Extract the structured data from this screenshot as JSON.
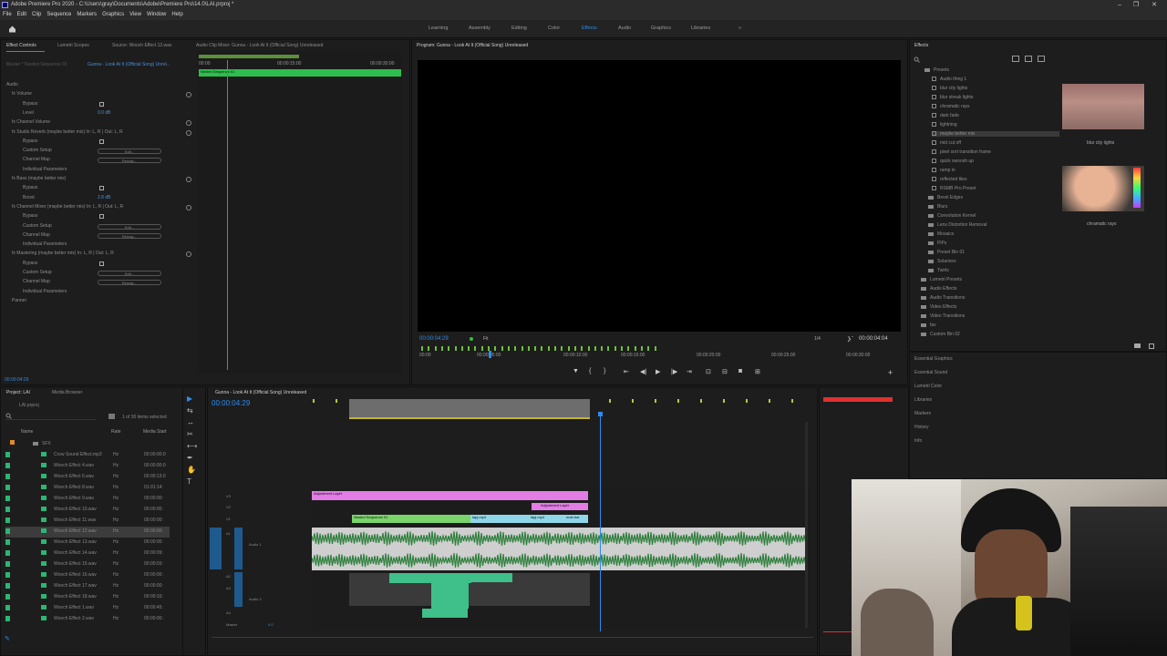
{
  "app": {
    "title": "Adobe Premiere Pro 2020 - C:\\Users\\gray\\Documents\\Adobe\\Premiere Pro\\14.0\\LAI.prproj *",
    "menu": [
      "File",
      "Edit",
      "Clip",
      "Sequence",
      "Markers",
      "Graphics",
      "View",
      "Window",
      "Help"
    ]
  },
  "workspaces": [
    "Learning",
    "Assembly",
    "Editing",
    "Color",
    "Effects",
    "Audio",
    "Graphics",
    "Libraries"
  ],
  "active_workspace": "Effects",
  "more_glyph": "»",
  "source_panel": {
    "tabs": [
      "Effect Controls",
      "Lumetri Scopes",
      "Source: Wooch Effect 12.wav",
      "Audio Clip Mixer: Gunna - Look At It (Official Song) Unreleased"
    ],
    "clip_path": "Master * Nested Sequence 01",
    "clip_name": "Gunna - Look At It (Official Song) Unrel...",
    "time_start": "00:00",
    "time_mid": "00:00:15:00",
    "time_end": "00:00:30:00",
    "nested_clip": "Nested Sequence 01",
    "timecode": "00:00:04:29",
    "rows": [
      {
        "text": "Audio",
        "indent": 0
      },
      {
        "text": "fx  Volume",
        "indent": 1
      },
      {
        "text": "Bypass",
        "indent": 3,
        "checkbox": true
      },
      {
        "text": "Level",
        "indent": 3,
        "value": "0.0 dB"
      },
      {
        "text": "fx  Channel Volume",
        "indent": 1
      },
      {
        "text": "fx  Studio Reverb (maybe better mix)  In: L, R | Out: L, R",
        "indent": 1
      },
      {
        "text": "Bypass",
        "indent": 3,
        "checkbox": true
      },
      {
        "text": "Custom Setup",
        "indent": 3,
        "button": "Edit..."
      },
      {
        "text": "Channel Map",
        "indent": 3,
        "button": "Remap..."
      },
      {
        "text": "Individual Parameters",
        "indent": 3
      },
      {
        "text": "fx  Bass (maybe better mix)",
        "indent": 1
      },
      {
        "text": "Bypass",
        "indent": 3,
        "checkbox": true
      },
      {
        "text": "Boost",
        "indent": 3,
        "value": "2.8 dB"
      },
      {
        "text": "fx  Channel Mixer (maybe better mix)  In: L, R | Out: L, R",
        "indent": 1
      },
      {
        "text": "Bypass",
        "indent": 3,
        "checkbox": true
      },
      {
        "text": "Custom Setup",
        "indent": 3,
        "button": "Edit..."
      },
      {
        "text": "Channel Map",
        "indent": 3,
        "button": "Remap..."
      },
      {
        "text": "Individual Parameters",
        "indent": 3
      },
      {
        "text": "fx  Mastering (maybe better mix)  In: L, R | Out: L, R",
        "indent": 1
      },
      {
        "text": "Bypass",
        "indent": 3,
        "checkbox": true
      },
      {
        "text": "Custom Setup",
        "indent": 3,
        "button": "Edit..."
      },
      {
        "text": "Channel Map",
        "indent": 3,
        "button": "Remap..."
      },
      {
        "text": "Individual Parameters",
        "indent": 3
      },
      {
        "text": "Panner",
        "indent": 1
      }
    ]
  },
  "program": {
    "tab": "Program: Gunna - Look At It (Official Song) Unreleased",
    "timecode": "00:00:04:29",
    "fit": "Fit",
    "resolution": "1/4",
    "duration": "00:00:04:04",
    "ruler": [
      "00:00",
      "00:00:05:00",
      "00:00:10:00",
      "00:00:15:00",
      "00:00:20:00",
      "00:00:25:00",
      "00:00:30:00"
    ],
    "controls": [
      "marker",
      "in",
      "out",
      "go-to-in",
      "step-back",
      "play",
      "step-forward",
      "go-to-out",
      "insert",
      "overwrite",
      "export-frame",
      "button-editor"
    ],
    "add": "+"
  },
  "effects_panel": {
    "tab": "Effects",
    "presets_label": "Presets",
    "presets": [
      "Audio thing 1",
      "blur city lights",
      "blur streak lights",
      "chramatic rays",
      "dark fade",
      "lightning",
      "maybe better mix",
      "mid cut off",
      "pixel sort transition frame",
      "quick swoosh up",
      "ramp in",
      "reflected tiles",
      "RSMB Pro Preset"
    ],
    "selected_preset": "maybe better mix",
    "bins": [
      "Bevel Edges",
      "Blurs",
      "Convolution Kernel",
      "Lens Distortion Removal",
      "Mosaics",
      "PiPs",
      "Preset Bin 01",
      "Solarizes",
      "Twirls"
    ],
    "categories": [
      "Lumetri Presets",
      "Audio Effects",
      "Audio Transitions",
      "Video Effects",
      "Video Transitions",
      "fav",
      "Custom Bin 02"
    ],
    "preview_1": "blur city lights",
    "preview_2": "chramatic rays",
    "other_panels": [
      "Essential Graphics",
      "Essential Sound",
      "Lumetri Color",
      "Libraries",
      "Markers",
      "History",
      "Info"
    ]
  },
  "project_panel": {
    "tabs": [
      "Project: LAI",
      "Media Browser"
    ],
    "project_file": "LAI.prproj",
    "selection": "1 of 30 items selected",
    "columns": [
      "Name",
      "Rate",
      "Media Start"
    ],
    "folder": "SFX",
    "items": [
      {
        "name": "Crow Sound Effect.mp3",
        "rate": "Hz",
        "start": "00:00:00:0"
      },
      {
        "name": "Wooch Effect 4.wav",
        "rate": "Hz",
        "start": "00:00:00:0"
      },
      {
        "name": "Wooch Effect 6.wav",
        "rate": "Hz",
        "start": "00:00:13:0"
      },
      {
        "name": "Wooch Effect 8.wav",
        "rate": "Hz",
        "start": "01:01:14:"
      },
      {
        "name": "Wooch Effect 9.wav",
        "rate": "Hz",
        "start": "00:00:00:"
      },
      {
        "name": "Wooch Effect 10.wav",
        "rate": "Hz",
        "start": "00:00:00:"
      },
      {
        "name": "Wooch Effect 11.wav",
        "rate": "Hz",
        "start": "00:00:00:"
      },
      {
        "name": "Wooch Effect 12.wav",
        "rate": "Hz",
        "start": "00:00:00:"
      },
      {
        "name": "Wooch Effect 13.wav",
        "rate": "Hz",
        "start": "00:00:00:"
      },
      {
        "name": "Wooch Effect 14.wav",
        "rate": "Hz",
        "start": "00:00:09:"
      },
      {
        "name": "Wooch Effect 15.wav",
        "rate": "Hz",
        "start": "00:00:03:"
      },
      {
        "name": "Wooch Effect 16.wav",
        "rate": "Hz",
        "start": "00:00:00:"
      },
      {
        "name": "Wooch Effect 17.wav",
        "rate": "Hz",
        "start": "00:00:00:"
      },
      {
        "name": "Wooch Effect 18.wav",
        "rate": "Hz",
        "start": "00:00:10:"
      },
      {
        "name": "Wooch Effect 1.wav",
        "rate": "Hz",
        "start": "00:00:45:"
      },
      {
        "name": "Wooch Effect 2.wav",
        "rate": "Hz",
        "start": "00:00:00:"
      }
    ],
    "selected_item": "Wooch Effect 12.wav"
  },
  "timeline": {
    "tab": "Gunna - Look At It (Official Song) Unreleased",
    "timecode": "00:00:04:29",
    "tracks": [
      "V3",
      "V2",
      "V1",
      "A1",
      "A2",
      "A3",
      "A4",
      "Master"
    ],
    "master_value": "0.0",
    "audio_label_a1": "Audio 1",
    "audio_label_a3": "Audio 3",
    "clips": {
      "adjustment_1": "Adjustment Layer",
      "adjustment_2": "Adjustment Layer",
      "nested": "Nested Sequence 01",
      "mp4_1": "lapj.mp4",
      "mp4_2": "lapj.mp4",
      "mp4_3": "mob.bar"
    }
  },
  "colors": {
    "accent": "#2d8ceb",
    "clip_green": "#7ad46b",
    "clip_pink": "#e27de6",
    "clip_cyan": "#8fd7e8",
    "audio_green": "#2e7f3c",
    "label_green": "#2bb673",
    "meter_red": "#e03030"
  }
}
